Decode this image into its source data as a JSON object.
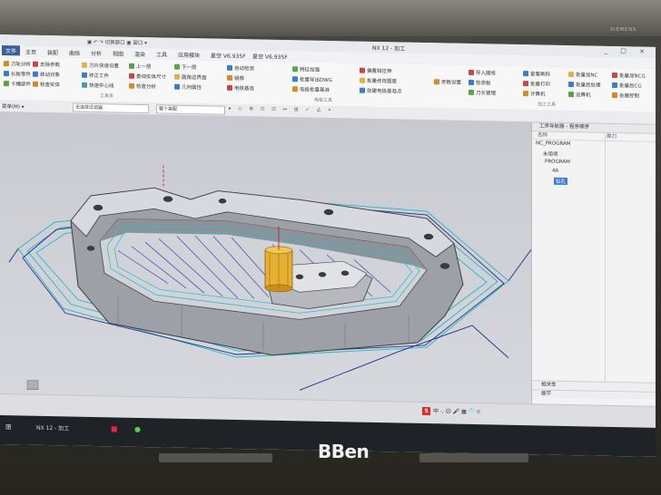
{
  "monitor": {
    "brand": "SIEMENS",
    "laptop_logo": "BBen"
  },
  "titlebar": {
    "title": "NX 12 - 加工",
    "quick": "▣ ↶ ↷ 切换窗口 ▣ 窗口 ▾"
  },
  "tabs": [
    "文件",
    "主页",
    "装配",
    "曲线",
    "分析",
    "视图",
    "渲染",
    "工具",
    "应用模块",
    "星空 V6.935F",
    "星空 V6.935F"
  ],
  "ribbon": {
    "col1": [
      "刀轨分析",
      "长板零件",
      "卡槽部件"
    ],
    "col2": [
      "去除参数",
      "移动对象",
      "检查实体"
    ],
    "col3": [
      "刀片快速设置",
      "修正工件",
      "快速中心线"
    ],
    "col4": [
      "上一层",
      "查询实体尺寸",
      "检查分析"
    ],
    "col5": [
      "下一层",
      "圆角边界盘",
      "几何属性"
    ],
    "col6": [
      "自动检测",
      "镜像",
      "电极基准"
    ],
    "col7": [
      "特征加强",
      "批量导出DWG",
      "电极批量基准"
    ],
    "col8": [
      "偏置和拉伸",
      "批量修改圆度",
      "创建电极基准点"
    ],
    "col9": [
      "参数设置"
    ],
    "col10": [
      "导入图纸",
      "检测板",
      "刀长管理"
    ],
    "col11": [
      "查看刷标",
      "批量打印",
      "计算机"
    ],
    "col12": [
      "批量加NC",
      "批量后处理",
      "运算机"
    ],
    "col13": [
      "批量加NCG",
      "批量后CG",
      "会展控制"
    ],
    "group_labels": [
      "工具条",
      "电极工具",
      "加工工具"
    ]
  },
  "toolbar2": {
    "filter_label": "菜单(M) ▾",
    "filter_value": "无选择过滤器",
    "assembly_value": "整个装配"
  },
  "navigator": {
    "header": "工序导航器 - 程序顺序",
    "col_name": "名称",
    "col_toolchange": "换刀",
    "items": [
      "NC_PROGRAM",
      "未用项",
      "PROGRAM",
      "4A",
      "钻孔"
    ],
    "bottom1": "相关性",
    "bottom2": "细节"
  },
  "ime": {
    "label": "中 ·, ☺ 🎤 ▦ 👕 ⁞⁞"
  },
  "taskbar": {
    "app": "NX 12 - 加工"
  }
}
